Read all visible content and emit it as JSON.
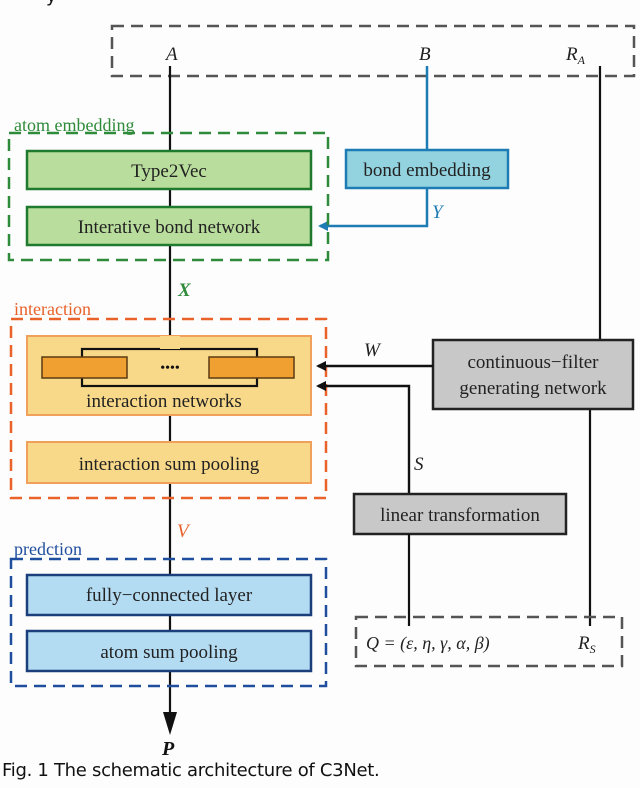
{
  "figure": {
    "caption": "Fig. 1 The schematic architecture of C3Net.",
    "top_fragment": "y"
  },
  "inputs": {
    "a": "A",
    "b": "B",
    "ra_main": "R",
    "ra_sub": "A",
    "q": "Q = (ε, η, γ, α, β)",
    "rs_main": "R",
    "rs_sub": "S"
  },
  "groups": {
    "atom_embedding": {
      "label": "atom embedding",
      "color": "#2e8b3a"
    },
    "interaction": {
      "label": "interaction",
      "color": "#e8622a"
    },
    "prediction": {
      "label": "predction",
      "color": "#1f4e9e"
    }
  },
  "blocks": {
    "type2vec": "Type2Vec",
    "interative_bond_network": "Interative bond network",
    "bond_embedding": "bond embedding",
    "interaction_networks": "interaction networks",
    "interaction_dots": "••••",
    "interaction_sum_pooling": "interaction sum pooling",
    "cfgn_line1": "continuous−filter",
    "cfgn_line2": "generating network",
    "linear_transformation": "linear transformation",
    "fully_connected": "fully−connected layer",
    "atom_sum_pooling": "atom sum pooling"
  },
  "variables": {
    "x": "X",
    "y": "Y",
    "w": "W",
    "s": "S",
    "v": "V",
    "p": "P"
  },
  "colors": {
    "green_fill": "#b9dd9c",
    "green_stroke": "#1f7a2e",
    "blue_fill": "#92d3df",
    "blue_stroke": "#1e7cb4",
    "orange_fill": "#f8d98a",
    "orange_stroke": "#f0a05a",
    "orange_inner": "#f0a030",
    "lightblue_fill": "#b3dcf2",
    "navy_stroke": "#1b3f7a",
    "gray_fill": "#c8c8c8",
    "dash_gray": "#555555"
  }
}
